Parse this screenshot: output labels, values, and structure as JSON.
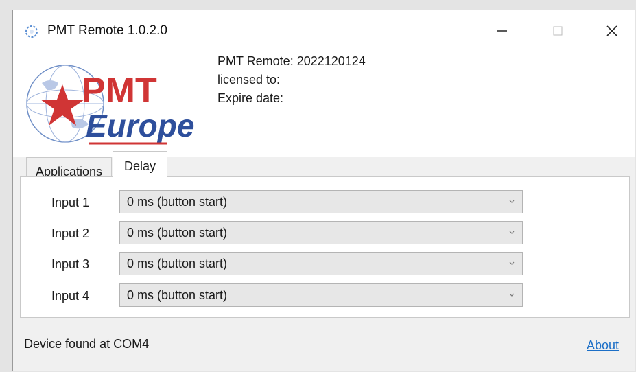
{
  "window": {
    "title": "PMT Remote 1.0.2.0"
  },
  "header": {
    "version_line": "PMT Remote: 2022120124",
    "licensed_line": "licensed to:",
    "expire_line": "Expire date:",
    "logo": {
      "text_top": "PMT",
      "text_bottom": "Europe",
      "colors": {
        "red": "#d03535",
        "blue": "#2e4f9c"
      }
    }
  },
  "tabs": [
    {
      "label": "Applications",
      "selected": false
    },
    {
      "label": "Delay",
      "selected": true
    }
  ],
  "delay": {
    "inputs": [
      {
        "label": "Input 1",
        "value": "0 ms (button start)"
      },
      {
        "label": "Input 2",
        "value": "0 ms (button start)"
      },
      {
        "label": "Input 3",
        "value": "0 ms (button start)"
      },
      {
        "label": "Input 4",
        "value": "0 ms (button start)"
      }
    ]
  },
  "footer": {
    "status": "Device found at COM4",
    "about_link": "About"
  },
  "icons": {
    "app": "globe-spinner-icon",
    "minimize": "minimize-icon",
    "maximize": "maximize-icon",
    "close": "close-icon",
    "dropdown": "chevron-down-icon"
  },
  "colors": {
    "link": "#1c6fc7",
    "window_bg": "#f0f0f0",
    "combo_bg": "#e7e7e7"
  }
}
